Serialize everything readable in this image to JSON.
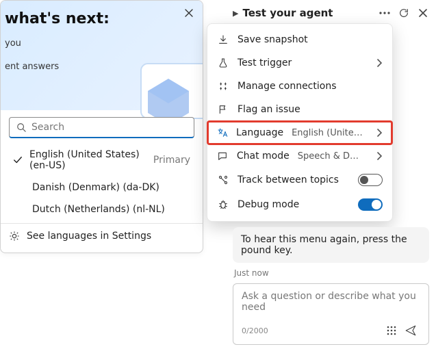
{
  "hero": {
    "title": "what's next:",
    "line1": "you",
    "line2": "ent answers"
  },
  "lang_picker": {
    "search_placeholder": "Search",
    "items": [
      {
        "label": "English (United States) (en-US)",
        "selected": true,
        "primary_tag": "Primary"
      },
      {
        "label": "Danish (Denmark) (da-DK)",
        "selected": false
      },
      {
        "label": "Dutch (Netherlands) (nl-NL)",
        "selected": false
      }
    ],
    "footer": "See languages in Settings"
  },
  "topbar": {
    "title": "Test your agent"
  },
  "menu": {
    "save_snapshot": "Save snapshot",
    "test_trigger": "Test trigger",
    "manage_connections": "Manage connections",
    "flag_issue": "Flag an issue",
    "language_label": "Language",
    "language_value": "English (United States)",
    "chat_mode_label": "Chat mode",
    "chat_mode_value": "Speech & DTMF",
    "track_topics": "Track between topics",
    "debug_mode": "Debug mode"
  },
  "chat": {
    "bubble": "To hear this menu again, press the pound key.",
    "timestamp": "Just now",
    "placeholder": "Ask a question or describe what you need",
    "counter": "0/2000"
  }
}
